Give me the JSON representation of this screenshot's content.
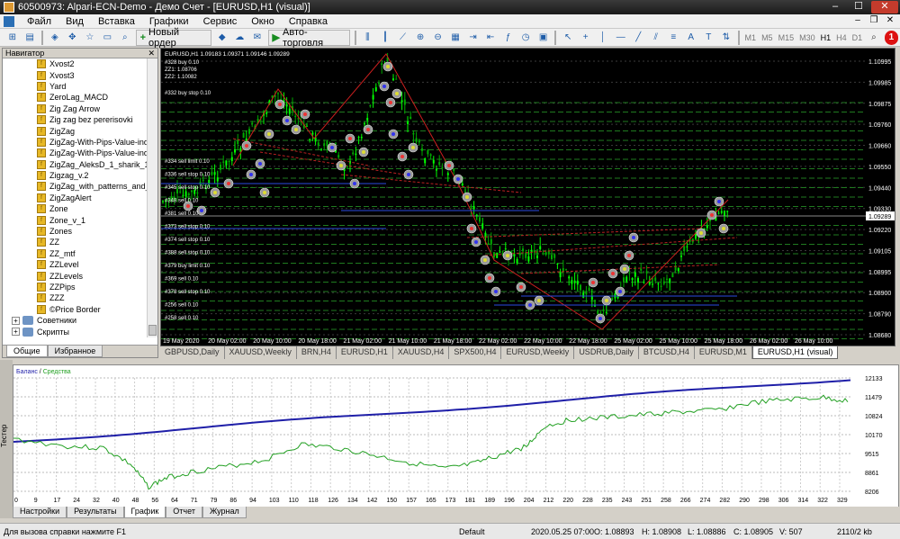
{
  "window": {
    "title": "60500973: Alpari-ECN-Demo - Демо Счет - [EURUSD,H1 (visual)]",
    "minimize": "‒",
    "maximize": "☐",
    "close": "✕"
  },
  "menu": [
    "Файл",
    "Вид",
    "Вставка",
    "Графики",
    "Сервис",
    "Окно",
    "Справка"
  ],
  "toolbar": {
    "new_order": "Новый ордер",
    "auto_trading": "Авто-торговля",
    "timeframes": [
      "M1",
      "M5",
      "M15",
      "M30",
      "H1",
      "H4",
      "D1"
    ],
    "alert_badge": "1"
  },
  "navigator": {
    "title": "Навигатор",
    "indicators": [
      "Xvost2",
      "Xvost3",
      "Yard",
      "ZeroLag_MACD",
      "Zig Zag Arrow",
      "Zig zag bez pererisovki",
      "ZigZag",
      "ZigZag-With-Pips-Value-indic",
      "ZigZag-With-Pips-Value-indic",
      "ZigZag_AleksD_1_sharik_11",
      "Zigzag_v.2",
      "ZigZag_with_patterns_and_valu",
      "ZigZagAlert",
      "Zone",
      "Zone_v_1",
      "Zones",
      "ZZ",
      "ZZ_mtf",
      "ZZLevel",
      "ZZLevels",
      "ZZPips",
      "ZZZ",
      "©Price Border"
    ],
    "folders": [
      "Советники",
      "Скрипты"
    ],
    "tabs": [
      "Общие",
      "Избранное"
    ]
  },
  "chart": {
    "header": "EURUSD,H1  1.09183 1.09371 1.09146 1.09289",
    "zz_labels": [
      "#328 buy 0.10",
      "ZZ1: 1.08706",
      "ZZ2: 1.10082",
      "#332 buy stop 0.10"
    ],
    "order_labels": [
      "#334 sell limit 0.10",
      "#336 sell stop 0.10",
      "#345 sell stop 0.10",
      "#348 sell 0.10",
      "#381 sell 0.10",
      "#373 sell stop 0.10",
      "#374 sell stop 0.10",
      "#388 sell stop 0.10",
      "#379 buy limit 0.10",
      "#369 sell 0.10",
      "#378 sell stop 0.10",
      "#256 sell 0.10",
      "#258 sell 0.10"
    ],
    "price_axis": [
      "1.10995",
      "1.09985",
      "1.09875",
      "1.09760",
      "1.09660",
      "1.09550",
      "1.09440",
      "1.09330",
      "1.09220",
      "1.09105",
      "1.08995",
      "1.08900",
      "1.08790",
      "1.08680"
    ],
    "current_price": "1.09289",
    "time_axis": [
      "19 May 2020",
      "20 May 02:00",
      "20 May 10:00",
      "20 May 18:00",
      "21 May 02:00",
      "21 May 10:00",
      "21 May 18:00",
      "22 May 02:00",
      "22 May 10:00",
      "22 May 18:00",
      "25 May 02:00",
      "25 May 10:00",
      "25 May 18:00",
      "26 May 02:00",
      "26 May 10:00"
    ],
    "colors": {
      "bull": "#00ff00",
      "bear": "#00aa00",
      "grid": "#3a3a3a",
      "zigzag": "#cc1f1f"
    }
  },
  "chart_tabs": [
    "GBPUSD,Daily",
    "XAUUSD,Weekly",
    "BRN,H4",
    "EURUSD,H1",
    "XAUUSD,H4",
    "SPX500,H4",
    "EURUSD,Weekly",
    "USDRUB,Daily",
    "BTCUSD,H4",
    "EURUSD,M1",
    "EURUSD,H1 (visual)"
  ],
  "tester": {
    "side_title": "Тестер",
    "legend_balance": "Баланс",
    "legend_sep": " / ",
    "legend_equity": "Средства",
    "y_axis": [
      "12133",
      "11479",
      "10824",
      "10170",
      "9515",
      "8861",
      "8206"
    ],
    "x_axis": [
      "0",
      "9",
      "17",
      "24",
      "32",
      "40",
      "48",
      "56",
      "64",
      "71",
      "79",
      "86",
      "94",
      "103",
      "110",
      "118",
      "126",
      "134",
      "142",
      "150",
      "157",
      "165",
      "173",
      "181",
      "189",
      "196",
      "204",
      "212",
      "220",
      "228",
      "235",
      "243",
      "251",
      "258",
      "266",
      "274",
      "282",
      "290",
      "298",
      "306",
      "314",
      "322",
      "329"
    ],
    "tabs": [
      "Настройки",
      "Результаты",
      "График",
      "Отчет",
      "Журнал"
    ],
    "active_tab": "График",
    "colors": {
      "balance": "#1f1fa8",
      "equity": "#22a022"
    }
  },
  "status": {
    "help": "Для вызова справки нажмите F1",
    "profile": "Default",
    "datetime": "2020.05.25 07:00",
    "open": "O: 1.08893",
    "high": "H: 1.08908",
    "low": "L: 1.08886",
    "close": "C: 1.08905",
    "volume": "V: 507",
    "traffic": "2110/2 kb"
  }
}
